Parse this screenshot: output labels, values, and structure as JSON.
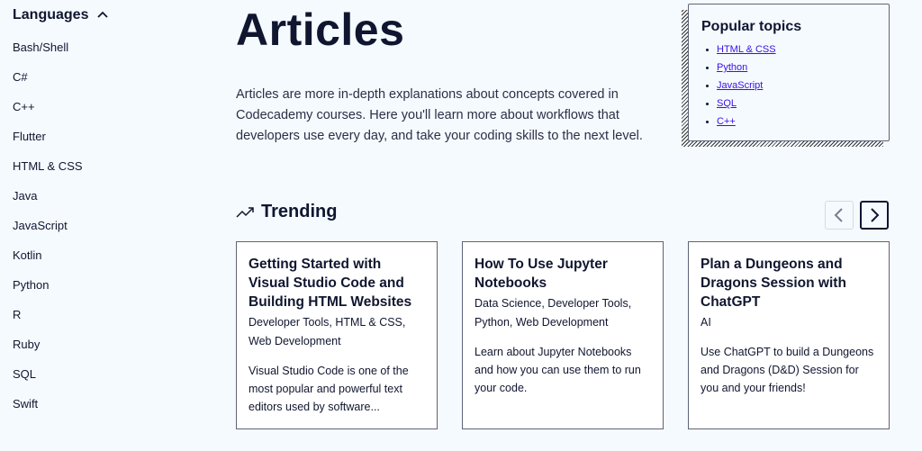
{
  "sidebar": {
    "header": "Languages",
    "items": [
      {
        "label": "Bash/Shell"
      },
      {
        "label": "C#"
      },
      {
        "label": "C++"
      },
      {
        "label": "Flutter"
      },
      {
        "label": "HTML & CSS"
      },
      {
        "label": "Java"
      },
      {
        "label": "JavaScript"
      },
      {
        "label": "Kotlin"
      },
      {
        "label": "Python"
      },
      {
        "label": "R"
      },
      {
        "label": "Ruby"
      },
      {
        "label": "SQL"
      },
      {
        "label": "Swift"
      }
    ]
  },
  "main": {
    "title": "Articles",
    "intro": "Articles are more in-depth explanations about concepts covered in Codecademy courses. Here you'll learn more about workflows that developers use every day, and take your coding skills to the next level."
  },
  "popular_topics": {
    "title": "Popular topics",
    "links": [
      {
        "label": "HTML & CSS"
      },
      {
        "label": "Python"
      },
      {
        "label": "JavaScript"
      },
      {
        "label": "SQL"
      },
      {
        "label": "C++"
      }
    ]
  },
  "trending": {
    "title": "Trending",
    "icon": "trending-up-icon",
    "cards": [
      {
        "title": "Getting Started with Visual Studio Code and Building HTML Websites",
        "tags": "Developer Tools, HTML & CSS, Web Development",
        "description": "Visual Studio Code is one of the most popular and powerful text editors used by software..."
      },
      {
        "title": "How To Use Jupyter Notebooks",
        "tags": "Data Science, Developer Tools, Python, Web Development",
        "description": "Learn about Jupyter Notebooks and how you can use them to run your code."
      },
      {
        "title": "Plan a Dungeons and Dragons Session with ChatGPT",
        "tags": "AI",
        "description": "Use ChatGPT to build a Dungeons and Dragons (D&D) Session for you and your friends!"
      }
    ]
  },
  "colors": {
    "background": "#f5faff",
    "text": "#10162f",
    "link": "#3a10e5",
    "border": "#5e6478"
  }
}
